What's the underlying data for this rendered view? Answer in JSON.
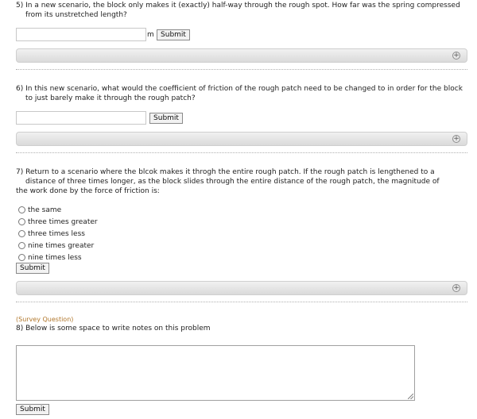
{
  "q5": {
    "text": "5) In a new scenario, the block only makes it (exactly) half-way through the rough spot. How far was the spring compressed from its unstretched length?",
    "unit": "m",
    "submit_label": "Submit",
    "expand_icon": "plus-circle-icon"
  },
  "q6": {
    "text": "6) In this new scenario, what would the coefficient of friction of the rough patch need to be changed to in order for the block to just barely make it through the rough patch?",
    "submit_label": "Submit",
    "expand_icon": "plus-circle-icon"
  },
  "q7": {
    "text_line1": "7) Return to a scenario where the blcok makes it throgh the entire rough patch. If the rough patch is lengthened to a",
    "text_line2": "distance of three times longer, as the block slides through the entire distance of the rough patch, the magnitude of",
    "text_line3": "the work done by the force of friction is:",
    "options": [
      "the same",
      "three times greater",
      "three times less",
      "nine times greater",
      "nine times less"
    ],
    "submit_label": "Submit",
    "expand_icon": "plus-circle-icon"
  },
  "q8": {
    "tag": "(Survey Question)",
    "text": "8) Below is some space to write notes on this problem",
    "notes_value": "",
    "submit_label": "Submit"
  }
}
